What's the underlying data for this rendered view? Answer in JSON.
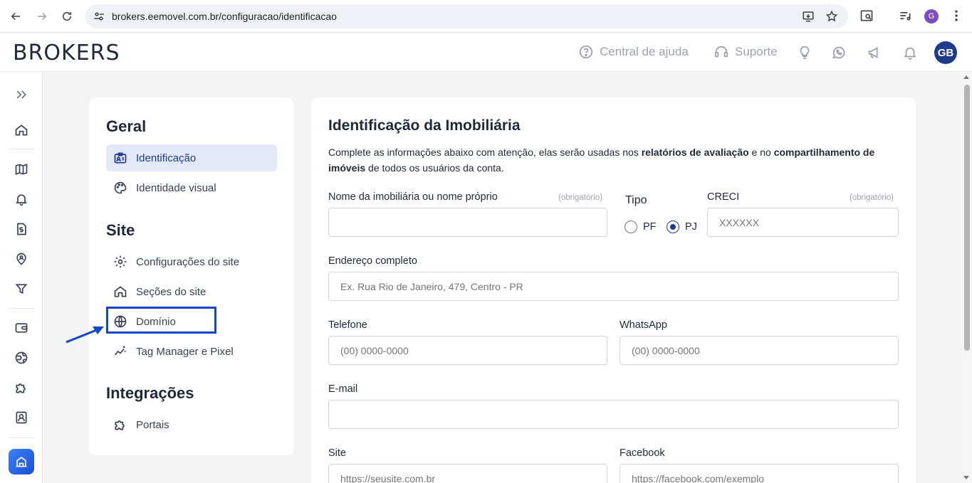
{
  "browser": {
    "url": "brokers.eemovel.com.br/configuracao/identificacao",
    "profile_initial": "G"
  },
  "header": {
    "logo": "BROKERS",
    "help_label": "Central de ajuda",
    "support_label": "Suporte",
    "user_initials": "GB"
  },
  "settings": {
    "sections": {
      "geral": "Geral",
      "site": "Site",
      "integracoes": "Integrações"
    },
    "items": {
      "identificacao": "Identificação",
      "identidade_visual": "Identidade visual",
      "config_site": "Configurações do site",
      "secoes_site": "Seções do site",
      "dominio": "Domínio",
      "tag_manager": "Tag Manager e Pixel",
      "portais": "Portais"
    }
  },
  "form": {
    "title": "Identificação da Imobiliária",
    "desc_part1": "Complete as informações abaixo com atenção, elas serão usadas nos ",
    "desc_bold1": "relatórios de avaliação",
    "desc_part2": " e no ",
    "desc_bold2": "compartilhamento de imóveis",
    "desc_part3": " de todos os usuários da conta.",
    "required_text": "(obrigatório)",
    "nome_label": "Nome da imobiliária ou nome próprio",
    "nome_value": "",
    "tipo_label": "Tipo",
    "tipo_pf": "PF",
    "tipo_pj": "PJ",
    "tipo_selected": "PJ",
    "creci_label": "CRECI",
    "creci_placeholder": "XXXXXX",
    "endereco_label": "Endereço completo",
    "endereco_placeholder": "Ex. Rua Rio de Janeiro, 479, Centro - PR",
    "telefone_label": "Telefone",
    "telefone_placeholder": "(00) 0000-0000",
    "whatsapp_label": "WhatsApp",
    "whatsapp_placeholder": "(00) 0000-0000",
    "email_label": "E-mail",
    "email_value": "",
    "site_label": "Site",
    "site_placeholder": "https://seusite.com.br",
    "facebook_label": "Facebook",
    "facebook_placeholder": "https://facebook.com/exemplo"
  },
  "colors": {
    "brand": "#1e3a8a",
    "active_bg": "#e3e9f8",
    "annotation": "#1546c9"
  }
}
